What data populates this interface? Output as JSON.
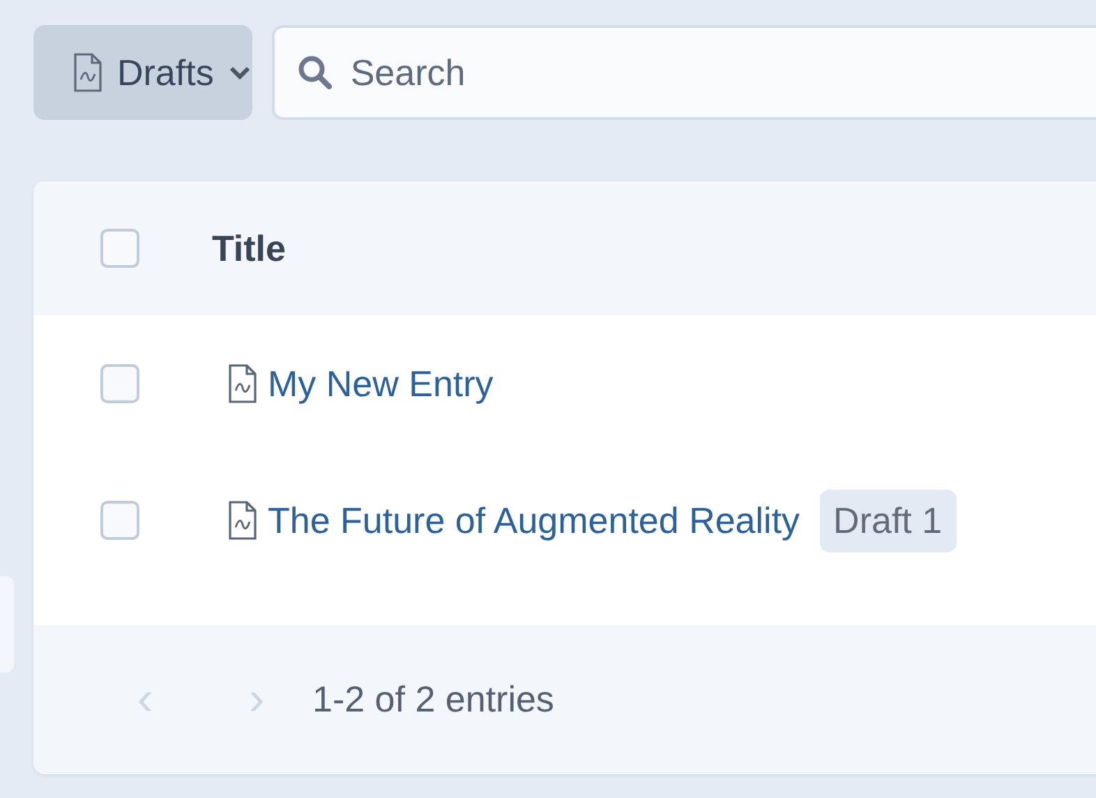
{
  "toolbar": {
    "view_button": {
      "label": "Drafts"
    },
    "search": {
      "placeholder": "Search"
    }
  },
  "table": {
    "header_checkbox": {
      "checked": false
    },
    "columns": [
      "Title"
    ],
    "rows": [
      {
        "checked": false,
        "title": "My New Entry"
      },
      {
        "checked": false,
        "title": "The Future of Augmented Reality",
        "badge": "Draft 1"
      }
    ]
  },
  "pagination": {
    "prev": {
      "label": "‹",
      "disabled": true
    },
    "next": {
      "label": "›",
      "disabled": true
    },
    "summary": "1-2 of 2 entries"
  }
}
